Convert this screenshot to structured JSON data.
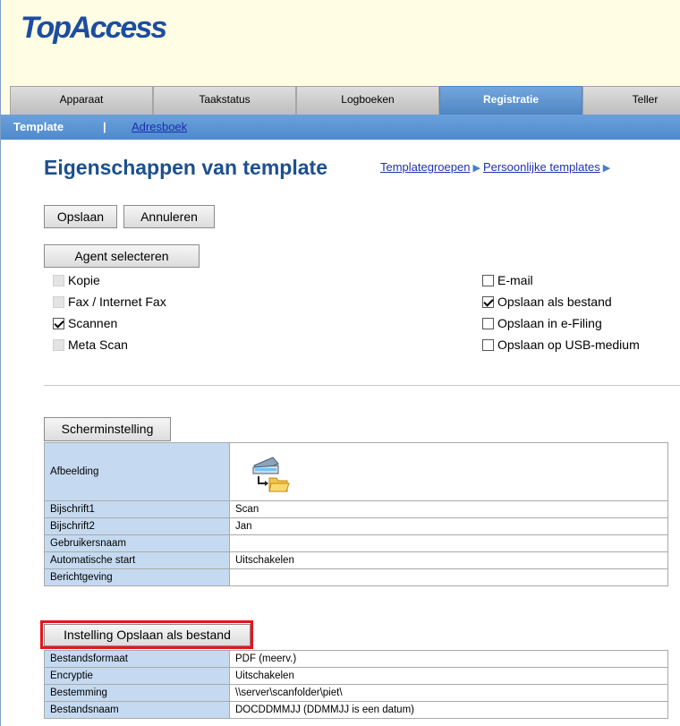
{
  "app": {
    "logo": "TopAccess"
  },
  "tabs": [
    {
      "label": "Apparaat",
      "active": false
    },
    {
      "label": "Taakstatus",
      "active": false
    },
    {
      "label": "Logboeken",
      "active": false
    },
    {
      "label": "Registratie",
      "active": true
    },
    {
      "label": "Teller",
      "active": false
    }
  ],
  "subnav": {
    "current": "Template",
    "separator": "|",
    "link": "Adresboek"
  },
  "page": {
    "title": "Eigenschappen van template",
    "crumb1": "Templategroepen",
    "crumb2": "Persoonlijke templates"
  },
  "buttons": {
    "save": "Opslaan",
    "cancel": "Annuleren",
    "agent": "Agent selecteren",
    "screen": "Scherminstelling",
    "saveas": "Instelling Opslaan als bestand"
  },
  "agents_left": [
    {
      "label": "Kopie",
      "state": "disabled"
    },
    {
      "label": "Fax / Internet Fax",
      "state": "disabled"
    },
    {
      "label": "Scannen",
      "state": "checked"
    },
    {
      "label": "Meta Scan",
      "state": "disabled"
    }
  ],
  "agents_right": [
    {
      "label": "E-mail",
      "state": "unchecked"
    },
    {
      "label": "Opslaan als bestand",
      "state": "checked"
    },
    {
      "label": "Opslaan in e-Filing",
      "state": "unchecked"
    },
    {
      "label": "Opslaan op USB-medium",
      "state": "unchecked"
    }
  ],
  "screen_settings": {
    "image_label": "Afbeelding",
    "image_icon": "scan-to-folder-icon",
    "rows": [
      {
        "label": "Bijschrift1",
        "value": "Scan"
      },
      {
        "label": "Bijschrift2",
        "value": "Jan"
      },
      {
        "label": "Gebruikersnaam",
        "value": ""
      },
      {
        "label": "Automatische start",
        "value": "Uitschakelen"
      },
      {
        "label": "Berichtgeving",
        "value": ""
      }
    ]
  },
  "file_settings": {
    "rows": [
      {
        "label": "Bestandsformaat",
        "value": "PDF (meerv.)"
      },
      {
        "label": "Encryptie",
        "value": "Uitschakelen"
      },
      {
        "label": "Bestemming",
        "value": "\\\\server\\scanfolder\\piet\\"
      },
      {
        "label": "Bestandsnaam",
        "value": "DOCDDMMJJ (DDMMJJ is een datum)"
      }
    ]
  },
  "colors": {
    "accent": "#4f8acb",
    "highlight": "#e8141b",
    "label_bg": "#c5daf0"
  }
}
